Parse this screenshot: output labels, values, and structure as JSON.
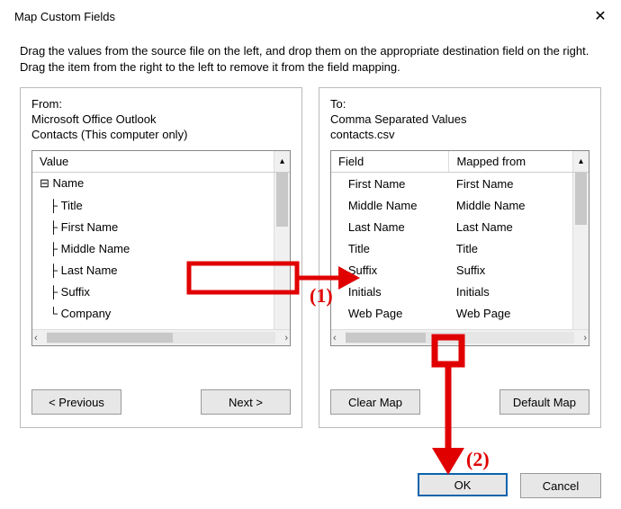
{
  "window": {
    "title": "Map Custom Fields",
    "close_glyph": "✕"
  },
  "instructions": "Drag the values from the source file on the left, and drop them on the appropriate destination field on the right.  Drag the item from the right to the left to remove it from the field mapping.",
  "from": {
    "label": "From:",
    "line1": "Microsoft Office Outlook",
    "line2": "Contacts (This computer only)",
    "header": "Value",
    "items": [
      {
        "indent": 0,
        "expander": "⊟",
        "text": "Name"
      },
      {
        "indent": 1,
        "text": "Title"
      },
      {
        "indent": 1,
        "text": "First Name"
      },
      {
        "indent": 1,
        "text": "Middle Name"
      },
      {
        "indent": 1,
        "text": "Last Name"
      },
      {
        "indent": 1,
        "text": "Suffix"
      },
      {
        "indent": 1,
        "last": true,
        "text": "Company"
      }
    ]
  },
  "to": {
    "label": "To:",
    "line1": "Comma Separated Values",
    "line2": "contacts.csv",
    "header_field": "Field",
    "header_mapped": "Mapped from",
    "rows": [
      {
        "field": "First Name",
        "mapped": "First Name"
      },
      {
        "field": "Middle Name",
        "mapped": "Middle Name"
      },
      {
        "field": "Last Name",
        "mapped": "Last Name"
      },
      {
        "field": "Title",
        "mapped": "Title"
      },
      {
        "field": "Suffix",
        "mapped": "Suffix"
      },
      {
        "field": "Initials",
        "mapped": "Initials"
      },
      {
        "field": "Web Page",
        "mapped": "Web Page"
      }
    ]
  },
  "buttons": {
    "previous": "< Previous",
    "next": "Next >",
    "clear_map": "Clear Map",
    "default_map": "Default Map",
    "ok": "OK",
    "cancel": "Cancel"
  },
  "annotations": {
    "label1": "(1)",
    "label2": "(2)"
  },
  "glyphs": {
    "scroll_up": "▴",
    "scroll_left": "‹",
    "scroll_right": "›"
  }
}
